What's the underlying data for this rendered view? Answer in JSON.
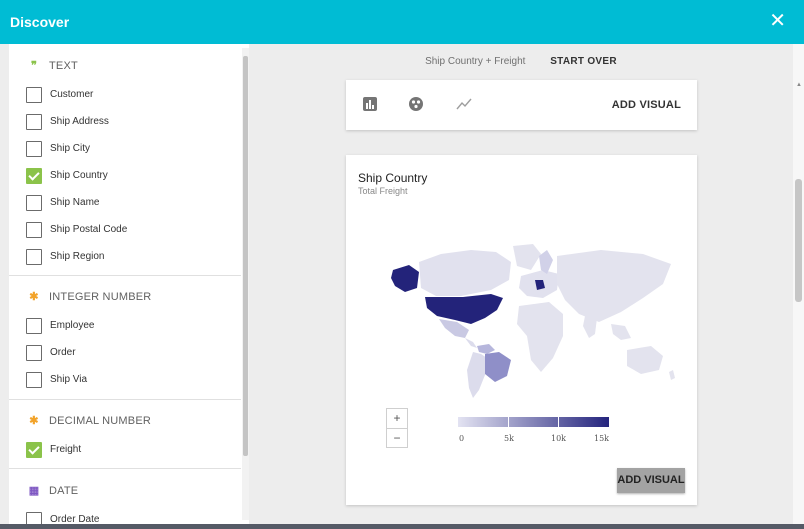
{
  "window": {
    "title": "Discover",
    "close_icon": "close-icon"
  },
  "sections": [
    {
      "name": "text",
      "title": "TEXT",
      "icon": "quote-icon",
      "icon_glyph": "99",
      "icon_color": "#8bc34a",
      "items": [
        {
          "label": "Customer",
          "checked": false
        },
        {
          "label": "Ship Address",
          "checked": false
        },
        {
          "label": "Ship City",
          "checked": false
        },
        {
          "label": "Ship Country",
          "checked": true
        },
        {
          "label": "Ship Name",
          "checked": false
        },
        {
          "label": "Ship Postal Code",
          "checked": false
        },
        {
          "label": "Ship Region",
          "checked": false
        }
      ]
    },
    {
      "name": "integer",
      "title": "INTEGER NUMBER",
      "icon": "number-icon",
      "icon_glyph": "✱",
      "icon_color": "#f2a32a",
      "items": [
        {
          "label": "Employee",
          "checked": false
        },
        {
          "label": "Order",
          "checked": false
        },
        {
          "label": "Ship Via",
          "checked": false
        }
      ]
    },
    {
      "name": "decimal",
      "title": "DECIMAL NUMBER",
      "icon": "number-icon",
      "icon_glyph": "✱",
      "icon_color": "#f2a32a",
      "items": [
        {
          "label": "Freight",
          "checked": true
        }
      ]
    },
    {
      "name": "date",
      "title": "DATE",
      "icon": "calendar-icon",
      "icon_glyph": "▦",
      "icon_color": "#7e57c2",
      "items": [
        {
          "label": "Order Date",
          "checked": false
        }
      ]
    }
  ],
  "topbar": {
    "breadcrumb": "Ship Country + Freight",
    "start_over": "START OVER"
  },
  "toolbar": {
    "icons": [
      "bar-chart-icon",
      "map-icon",
      "line-chart-icon"
    ],
    "add_visual": "ADD VISUAL"
  },
  "map_card": {
    "title": "Ship Country",
    "subtitle": "Total Freight",
    "zoom_in": "+",
    "zoom_out": "−",
    "legend_labels": [
      "0",
      "5k",
      "10k",
      "15k"
    ],
    "legend_low_color": "#e3e3f2",
    "legend_high_color": "#24247d",
    "add_visual": "ADD VISUAL"
  },
  "chart_data": {
    "type": "choropleth",
    "title": "Ship Country",
    "subtitle": "Total Freight",
    "scale": {
      "min": 0,
      "max": 15000,
      "ticks": [
        "0",
        "5k",
        "10k",
        "15k"
      ]
    },
    "highlighted_regions": [
      {
        "region": "USA",
        "level": "high"
      },
      {
        "region": "Germany",
        "level": "high"
      },
      {
        "region": "Brazil",
        "level": "medium"
      },
      {
        "region": "Mexico",
        "level": "low"
      },
      {
        "region": "Venezuela",
        "level": "low"
      },
      {
        "region": "France",
        "level": "low"
      },
      {
        "region": "UK",
        "level": "low"
      },
      {
        "region": "Sweden",
        "level": "low"
      },
      {
        "region": "Canada",
        "level": "low"
      },
      {
        "region": "Argentina",
        "level": "low"
      }
    ]
  }
}
